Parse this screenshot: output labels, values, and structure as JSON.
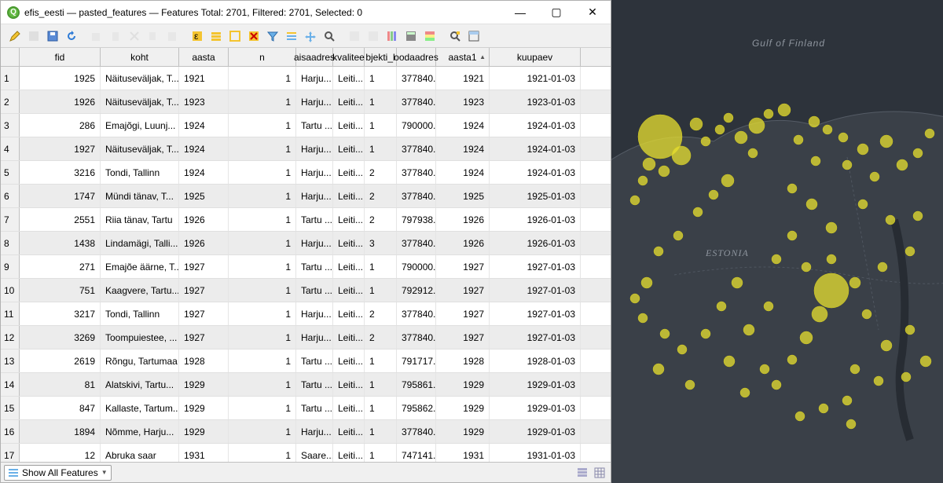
{
  "window": {
    "title": "efis_eesti — pasted_features — Features Total: 2701, Filtered: 2701, Selected: 0"
  },
  "columns": [
    {
      "key": "fid",
      "label": "fid",
      "w": "c-fid",
      "align": "r"
    },
    {
      "key": "koht",
      "label": "koht",
      "w": "c-koht",
      "align": "l"
    },
    {
      "key": "aasta",
      "label": "aasta",
      "w": "c-aasta",
      "align": "l"
    },
    {
      "key": "n",
      "label": "n",
      "w": "c-n",
      "align": "r"
    },
    {
      "key": "aisa",
      "label": "aisaadres",
      "w": "c-aisa",
      "align": "l"
    },
    {
      "key": "kval",
      "label": "kvalitee",
      "w": "c-kval",
      "align": "l"
    },
    {
      "key": "obj",
      "label": "bjekti_l",
      "w": "c-obj",
      "align": "l"
    },
    {
      "key": "koda",
      "label": "oodaadres",
      "w": "c-koda",
      "align": "l"
    },
    {
      "key": "a1",
      "label": "aasta1",
      "w": "c-a1",
      "align": "r",
      "sorted": true
    },
    {
      "key": "kuup",
      "label": "kuupaev",
      "w": "c-kuup",
      "align": "r"
    }
  ],
  "rows": [
    {
      "rn": "1",
      "fid": "1925",
      "koht": "Näituseväljak, T...",
      "aasta": "1921",
      "n": "1",
      "aisa": "Harju...",
      "kval": "Leiti...",
      "obj": "1",
      "koda": "377840...",
      "a1": "1921",
      "kuup": "1921-01-03"
    },
    {
      "rn": "2",
      "fid": "1926",
      "koht": "Näituseväljak, T...",
      "aasta": "1923",
      "n": "1",
      "aisa": "Harju...",
      "kval": "Leiti...",
      "obj": "1",
      "koda": "377840...",
      "a1": "1923",
      "kuup": "1923-01-03"
    },
    {
      "rn": "3",
      "fid": "286",
      "koht": "Emajõgi, Luunj...",
      "aasta": "1924",
      "n": "1",
      "aisa": "Tartu ...",
      "kval": "Leiti...",
      "obj": "1",
      "koda": "790000...",
      "a1": "1924",
      "kuup": "1924-01-03"
    },
    {
      "rn": "4",
      "fid": "1927",
      "koht": "Näituseväljak, T...",
      "aasta": "1924",
      "n": "1",
      "aisa": "Harju...",
      "kval": "Leiti...",
      "obj": "1",
      "koda": "377840...",
      "a1": "1924",
      "kuup": "1924-01-03"
    },
    {
      "rn": "5",
      "fid": "3216",
      "koht": "Tondi, Tallinn",
      "aasta": "1924",
      "n": "1",
      "aisa": "Harju...",
      "kval": "Leiti...",
      "obj": "2",
      "koda": "377840...",
      "a1": "1924",
      "kuup": "1924-01-03"
    },
    {
      "rn": "6",
      "fid": "1747",
      "koht": "Mündi tänav, T...",
      "aasta": "1925",
      "n": "1",
      "aisa": "Harju...",
      "kval": "Leiti...",
      "obj": "2",
      "koda": "377840...",
      "a1": "1925",
      "kuup": "1925-01-03"
    },
    {
      "rn": "7",
      "fid": "2551",
      "koht": "Riia tänav, Tartu",
      "aasta": "1926",
      "n": "1",
      "aisa": "Tartu ...",
      "kval": "Leiti...",
      "obj": "2",
      "koda": "797938...",
      "a1": "1926",
      "kuup": "1926-01-03"
    },
    {
      "rn": "8",
      "fid": "1438",
      "koht": "Lindamägi, Talli...",
      "aasta": "1926",
      "n": "1",
      "aisa": "Harju...",
      "kval": "Leiti...",
      "obj": "3",
      "koda": "377840...",
      "a1": "1926",
      "kuup": "1926-01-03"
    },
    {
      "rn": "9",
      "fid": "271",
      "koht": "Emajõe äärne, T...",
      "aasta": "1927",
      "n": "1",
      "aisa": "Tartu ...",
      "kval": "Leiti...",
      "obj": "1",
      "koda": "790000...",
      "a1": "1927",
      "kuup": "1927-01-03"
    },
    {
      "rn": "10",
      "fid": "751",
      "koht": "Kaagvere, Tartu...",
      "aasta": "1927",
      "n": "1",
      "aisa": "Tartu ...",
      "kval": "Leiti...",
      "obj": "1",
      "koda": "792912...",
      "a1": "1927",
      "kuup": "1927-01-03"
    },
    {
      "rn": "11",
      "fid": "3217",
      "koht": "Tondi, Tallinn",
      "aasta": "1927",
      "n": "1",
      "aisa": "Harju...",
      "kval": "Leiti...",
      "obj": "2",
      "koda": "377840...",
      "a1": "1927",
      "kuup": "1927-01-03"
    },
    {
      "rn": "12",
      "fid": "3269",
      "koht": "Toompuiestee, ...",
      "aasta": "1927",
      "n": "1",
      "aisa": "Harju...",
      "kval": "Leiti...",
      "obj": "2",
      "koda": "377840...",
      "a1": "1927",
      "kuup": "1927-01-03"
    },
    {
      "rn": "13",
      "fid": "2619",
      "koht": "Rõngu, Tartumaa",
      "aasta": "1928",
      "n": "1",
      "aisa": "Tartu ...",
      "kval": "Leiti...",
      "obj": "1",
      "koda": "791717...",
      "a1": "1928",
      "kuup": "1928-01-03"
    },
    {
      "rn": "14",
      "fid": "81",
      "koht": "Alatskivi, Tartu...",
      "aasta": "1929",
      "n": "1",
      "aisa": "Tartu ...",
      "kval": "Leiti...",
      "obj": "1",
      "koda": "795861...",
      "a1": "1929",
      "kuup": "1929-01-03"
    },
    {
      "rn": "15",
      "fid": "847",
      "koht": "Kallaste, Tartum...",
      "aasta": "1929",
      "n": "1",
      "aisa": "Tartu ...",
      "kval": "Leiti...",
      "obj": "1",
      "koda": "795862...",
      "a1": "1929",
      "kuup": "1929-01-03"
    },
    {
      "rn": "16",
      "fid": "1894",
      "koht": "Nõmme, Harju...",
      "aasta": "1929",
      "n": "1",
      "aisa": "Harju...",
      "kval": "Leiti...",
      "obj": "1",
      "koda": "377840...",
      "a1": "1929",
      "kuup": "1929-01-03"
    },
    {
      "rn": "17",
      "fid": "12",
      "koht": "Abruka saar",
      "aasta": "1931",
      "n": "1",
      "aisa": "Saare...",
      "kval": "Leiti...",
      "obj": "1",
      "koda": "747141...",
      "a1": "1931",
      "kuup": "1931-01-03"
    }
  ],
  "footer": {
    "combo_label": "Show All Features"
  },
  "map_labels": {
    "gulf": "Gulf of\nFinland",
    "estonia": "ESTONIA"
  },
  "map_points": [
    [
      62,
      174,
      28
    ],
    [
      89,
      198,
      12
    ],
    [
      48,
      209,
      8
    ],
    [
      67,
      218,
      7
    ],
    [
      108,
      158,
      8
    ],
    [
      120,
      180,
      6
    ],
    [
      40,
      230,
      6
    ],
    [
      30,
      255,
      6
    ],
    [
      138,
      165,
      6
    ],
    [
      149,
      150,
      6
    ],
    [
      165,
      175,
      8
    ],
    [
      185,
      160,
      10
    ],
    [
      180,
      195,
      6
    ],
    [
      148,
      230,
      8
    ],
    [
      130,
      248,
      6
    ],
    [
      110,
      270,
      6
    ],
    [
      85,
      300,
      6
    ],
    [
      60,
      320,
      6
    ],
    [
      45,
      360,
      7
    ],
    [
      30,
      380,
      6
    ],
    [
      40,
      405,
      6
    ],
    [
      200,
      145,
      6
    ],
    [
      220,
      140,
      8
    ],
    [
      238,
      178,
      6
    ],
    [
      258,
      155,
      7
    ],
    [
      260,
      205,
      6
    ],
    [
      275,
      165,
      6
    ],
    [
      295,
      175,
      6
    ],
    [
      230,
      240,
      6
    ],
    [
      255,
      260,
      7
    ],
    [
      280,
      290,
      7
    ],
    [
      230,
      300,
      6
    ],
    [
      210,
      330,
      6
    ],
    [
      248,
      340,
      6
    ],
    [
      280,
      330,
      6
    ],
    [
      280,
      370,
      22
    ],
    [
      265,
      400,
      10
    ],
    [
      248,
      430,
      8
    ],
    [
      230,
      458,
      6
    ],
    [
      210,
      490,
      6
    ],
    [
      195,
      470,
      6
    ],
    [
      170,
      500,
      6
    ],
    [
      150,
      460,
      7
    ],
    [
      175,
      420,
      7
    ],
    [
      200,
      390,
      6
    ],
    [
      160,
      360,
      7
    ],
    [
      140,
      390,
      6
    ],
    [
      120,
      425,
      6
    ],
    [
      300,
      210,
      6
    ],
    [
      320,
      190,
      7
    ],
    [
      335,
      225,
      6
    ],
    [
      350,
      180,
      8
    ],
    [
      370,
      210,
      7
    ],
    [
      390,
      195,
      6
    ],
    [
      405,
      170,
      6
    ],
    [
      320,
      260,
      6
    ],
    [
      355,
      280,
      6
    ],
    [
      390,
      275,
      6
    ],
    [
      380,
      320,
      6
    ],
    [
      345,
      340,
      6
    ],
    [
      310,
      360,
      7
    ],
    [
      325,
      400,
      6
    ],
    [
      350,
      440,
      7
    ],
    [
      380,
      420,
      6
    ],
    [
      400,
      460,
      7
    ],
    [
      375,
      480,
      6
    ],
    [
      340,
      485,
      6
    ],
    [
      310,
      470,
      6
    ],
    [
      300,
      510,
      6
    ],
    [
      270,
      520,
      6
    ],
    [
      240,
      530,
      6
    ],
    [
      305,
      540,
      6
    ],
    [
      60,
      470,
      7
    ],
    [
      90,
      445,
      6
    ],
    [
      68,
      425,
      6
    ],
    [
      100,
      490,
      6
    ]
  ]
}
